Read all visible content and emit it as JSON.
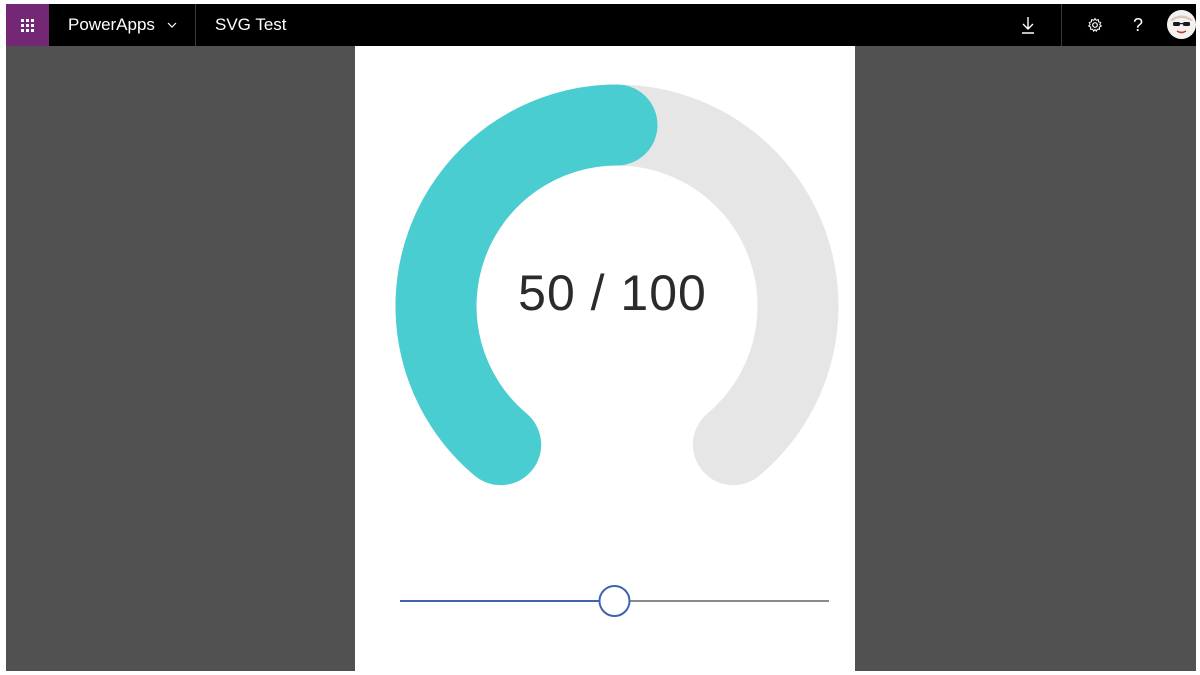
{
  "header": {
    "app_name": "PowerApps",
    "doc_title": "SVG Test",
    "icons": {
      "waffle": "waffle-icon",
      "dropdown": "chevron-down-icon",
      "download": "download-icon",
      "settings": "gear-icon",
      "help": "help-icon",
      "avatar": "avatar"
    }
  },
  "gauge": {
    "value": 50,
    "max": 100,
    "label": "50 / 100",
    "fill_color": "#4acdd0",
    "track_color": "#e6e6e6"
  },
  "slider": {
    "value": 50,
    "max": 100,
    "fill_color": "#3f63b0",
    "track_color": "#8a8a8a"
  },
  "colors": {
    "topbar": "#000000",
    "waffle_bg": "#742774",
    "workspace": "#515151",
    "canvas": "#ffffff"
  }
}
